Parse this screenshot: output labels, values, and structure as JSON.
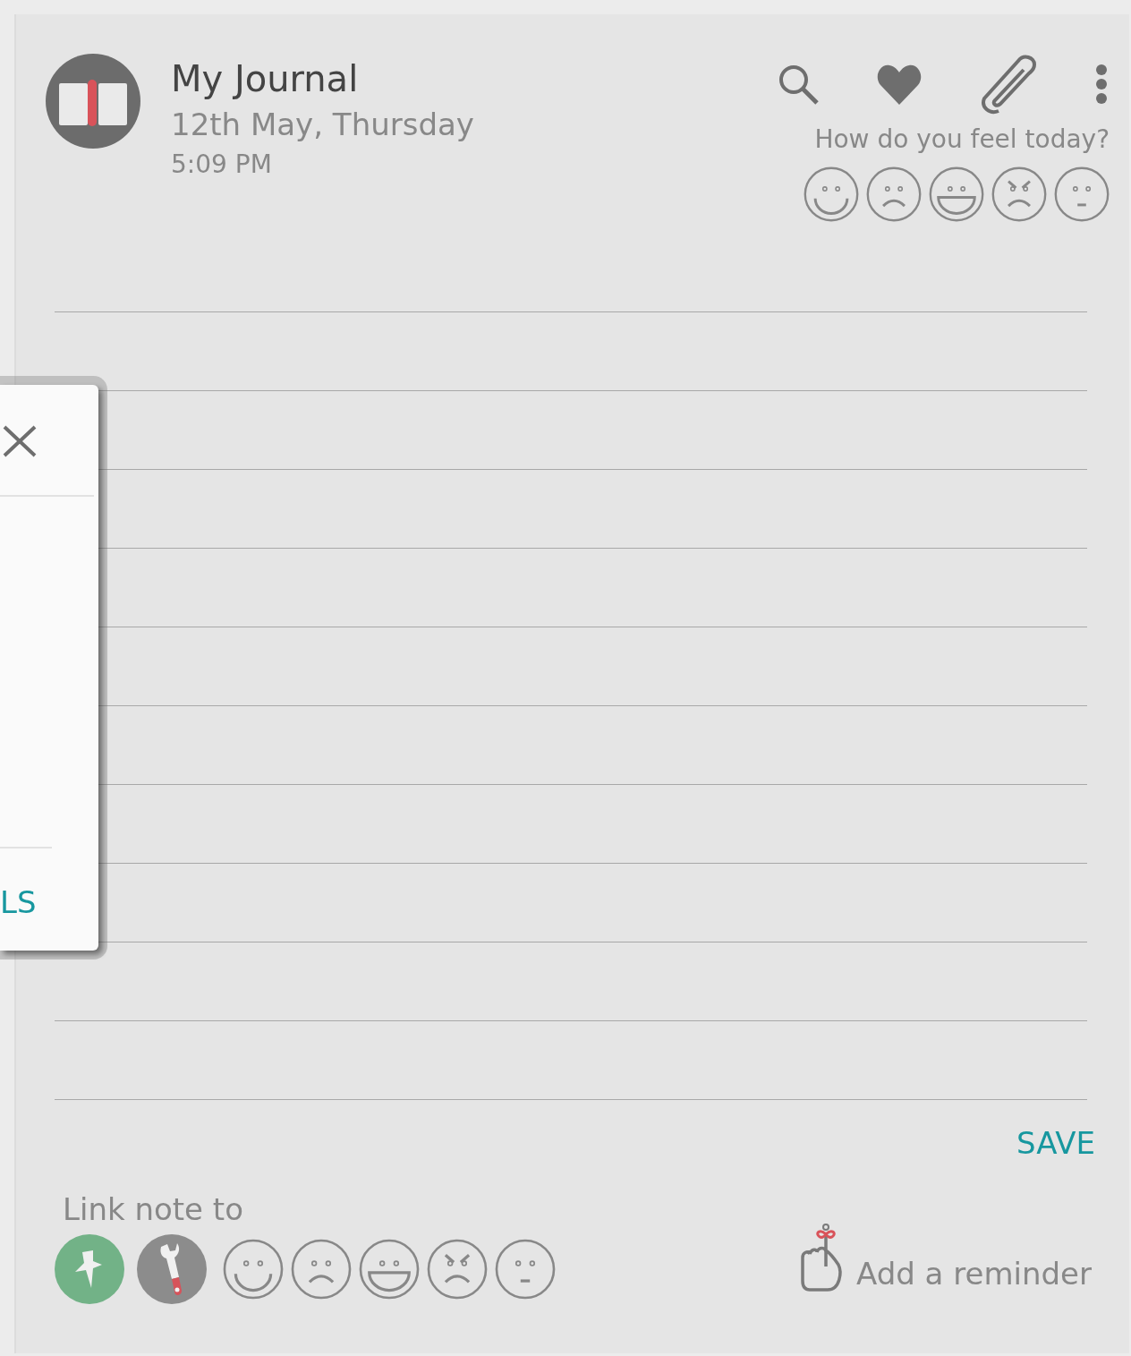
{
  "header": {
    "title": "My Journal",
    "date": "12th May, Thursday",
    "time": "5:09 PM"
  },
  "toolbar": [
    {
      "kind": "search"
    },
    {
      "kind": "favorite"
    },
    {
      "kind": "attach"
    },
    {
      "kind": "more"
    }
  ],
  "mood": {
    "prompt": "How do you feel today?",
    "faces": [
      {
        "kind": "smile"
      },
      {
        "kind": "sad"
      },
      {
        "kind": "laugh"
      },
      {
        "kind": "angry"
      },
      {
        "kind": "neutral"
      }
    ]
  },
  "save_button": "SAVE",
  "link": {
    "label": "Link note to",
    "tags": [
      {
        "kind": "pin",
        "color": "#72b287"
      },
      {
        "kind": "wrench",
        "color": "#8c8c8c"
      }
    ],
    "faces": [
      {
        "kind": "smile"
      },
      {
        "kind": "sad"
      },
      {
        "kind": "laugh"
      },
      {
        "kind": "angry"
      },
      {
        "kind": "neutral"
      }
    ]
  },
  "reminder": {
    "label": "Add a reminder"
  },
  "dialog": {
    "action": "LS"
  }
}
